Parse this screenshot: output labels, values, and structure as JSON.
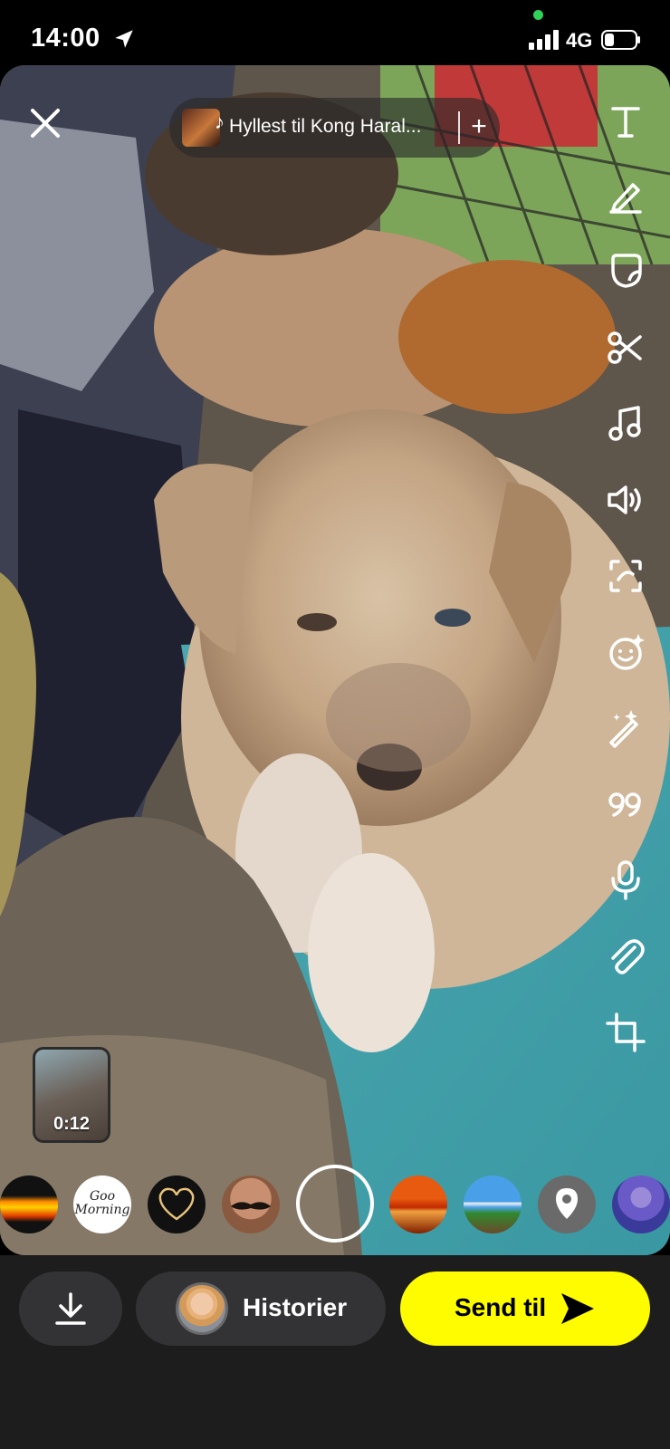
{
  "status_bar": {
    "time": "14:00",
    "network": "4G"
  },
  "music": {
    "title": "Hyllest til Kong Haral...",
    "add_label": "+"
  },
  "toolbar": {
    "icons": [
      "text-icon",
      "pencil-icon",
      "sticker-icon",
      "scissors-icon",
      "music-icon",
      "volume-icon",
      "lens-scan-icon",
      "emoji-sparkle-icon",
      "magic-wand-icon",
      "quote-icon",
      "microphone-icon",
      "paperclip-icon",
      "crop-icon"
    ]
  },
  "video_thumbnail": {
    "duration": "0:12"
  },
  "lenses": {
    "items": [
      "fire-lens",
      "good-morning-lens",
      "heart-lens",
      "mustache-lens",
      "selected-empty-lens",
      "sunset-lens",
      "landscape-lens",
      "location-lens",
      "portrait-lens"
    ],
    "good_morning_text": "Goo Morning"
  },
  "bottom_bar": {
    "stories_label": "Historier",
    "send_label": "Send til"
  },
  "colors": {
    "send_button": "#fffc00",
    "pill_background": "#333335",
    "bottom_background": "#1d1d1d"
  }
}
